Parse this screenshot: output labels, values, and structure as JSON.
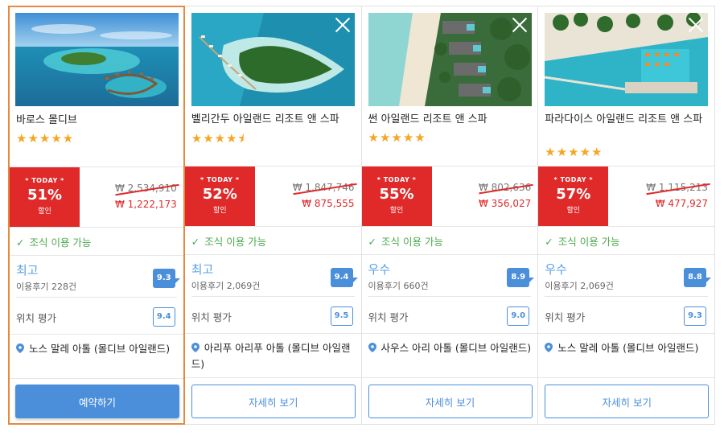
{
  "cards": [
    {
      "name": "바로스 몰디브",
      "stars": "★★★★★",
      "today_label": "* TODAY *",
      "discount": "51%",
      "discount_suffix": "할인",
      "original_price": "₩ 2,534,910",
      "sale_price": "₩ 1,222,173",
      "breakfast": "조식 이용 가능",
      "rating_word": "최고",
      "reviews": "이용후기 228건",
      "score": "9.3",
      "location_label": "위치 평가",
      "location_score": "9.4",
      "address": "노스 말레 아톨 (몰디브 아일랜드)",
      "button": "예약하기"
    },
    {
      "name": "벨리간두 아일랜드 리조트 앤 스파",
      "stars": "★★★★⯨",
      "today_label": "* TODAY *",
      "discount": "52%",
      "discount_suffix": "할인",
      "original_price": "₩ 1,847,746",
      "sale_price": "₩ 875,555",
      "breakfast": "조식 이용 가능",
      "rating_word": "최고",
      "reviews": "이용후기 2,069건",
      "score": "9.4",
      "location_label": "위치 평가",
      "location_score": "9.5",
      "address": "아리푸 아리푸 아톨 (몰디브 아일랜드)",
      "button": "자세히 보기"
    },
    {
      "name": "썬 아일랜드 리조트 앤 스파",
      "stars": "★★★★★",
      "today_label": "* TODAY *",
      "discount": "55%",
      "discount_suffix": "할인",
      "original_price": "₩ 802,636",
      "sale_price": "₩ 356,027",
      "breakfast": "조식 이용 가능",
      "rating_word": "우수",
      "reviews": "이용후기 660건",
      "score": "8.9",
      "location_label": "위치 평가",
      "location_score": "9.0",
      "address": "사우스 아리 아톨 (몰디브 아일랜드)",
      "button": "자세히 보기"
    },
    {
      "name": "파라다이스 아일랜드 리조트 앤 스파",
      "stars": "★★★★★",
      "today_label": "* TODAY *",
      "discount": "57%",
      "discount_suffix": "할인",
      "original_price": "₩ 1,115,213",
      "sale_price": "₩ 477,927",
      "breakfast": "조식 이용 가능",
      "rating_word": "우수",
      "reviews": "이용후기 2,069건",
      "score": "8.8",
      "location_label": "위치 평가",
      "location_score": "9.3",
      "address": "노스 말레 아톨 (몰디브 아일랜드)",
      "button": "자세히 보기"
    }
  ],
  "colors": {
    "accent": "#4b8fdb",
    "deal_red": "#e02a2a",
    "star": "#f5a623",
    "breakfast_green": "#4aa84a",
    "selected_border": "#e8883b"
  },
  "icons": [
    "close-icon",
    "check-icon",
    "location-pin-icon",
    "star-icon"
  ]
}
